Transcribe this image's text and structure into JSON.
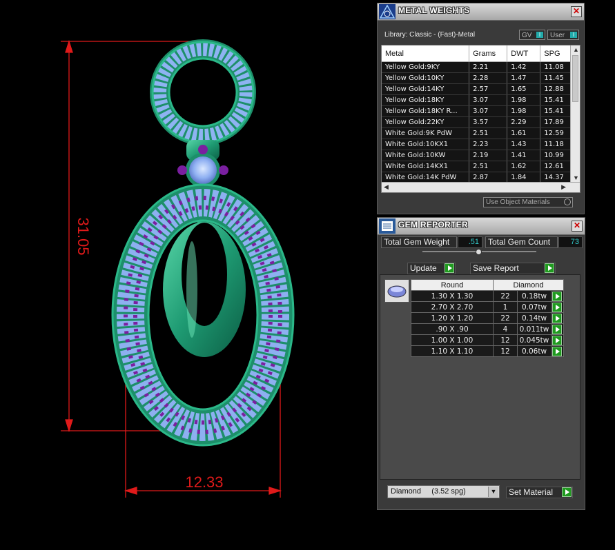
{
  "dimensions": {
    "height_value": "31.05",
    "width_value": "12.33",
    "color": "#e01a1a"
  },
  "metal_weights": {
    "title": "METAL WEIGHTS",
    "library": "Library: Classic - (Fast)-Metal",
    "gv_toggle": "GV",
    "user_toggle": "User",
    "columns": [
      "Metal",
      "Grams",
      "DWT",
      "SPG"
    ],
    "rows": [
      {
        "metal": "Yellow Gold:9KY",
        "grams": "2.21",
        "dwt": "1.42",
        "spg": "11.08"
      },
      {
        "metal": "Yellow Gold:10KY",
        "grams": "2.28",
        "dwt": "1.47",
        "spg": "11.45"
      },
      {
        "metal": "Yellow Gold:14KY",
        "grams": "2.57",
        "dwt": "1.65",
        "spg": "12.88"
      },
      {
        "metal": "Yellow Gold:18KY",
        "grams": "3.07",
        "dwt": "1.98",
        "spg": "15.41"
      },
      {
        "metal": "Yellow Gold:18KY R...",
        "grams": "3.07",
        "dwt": "1.98",
        "spg": "15.41"
      },
      {
        "metal": "Yellow Gold:22KY",
        "grams": "3.57",
        "dwt": "2.29",
        "spg": "17.89"
      },
      {
        "metal": "White Gold:9K PdW",
        "grams": "2.51",
        "dwt": "1.61",
        "spg": "12.59"
      },
      {
        "metal": "White Gold:10KX1",
        "grams": "2.23",
        "dwt": "1.43",
        "spg": "11.18"
      },
      {
        "metal": "White Gold:10KW",
        "grams": "2.19",
        "dwt": "1.41",
        "spg": "10.99"
      },
      {
        "metal": "White Gold:14KX1",
        "grams": "2.51",
        "dwt": "1.62",
        "spg": "12.61"
      },
      {
        "metal": "White Gold:14K PdW",
        "grams": "2.87",
        "dwt": "1.84",
        "spg": "14.37"
      }
    ],
    "use_object_materials": "Use Object Materials"
  },
  "gem_reporter": {
    "title": "GEM REPORTER",
    "total_weight_label": "Total Gem Weight",
    "total_weight_value": ".51",
    "total_count_label": "Total Gem Count",
    "total_count_value": "73",
    "update_label": "Update",
    "save_report_label": "Save Report",
    "shape_header": "Round",
    "material_header": "Diamond",
    "rows": [
      {
        "size": "1.30 X 1.30",
        "count": "22",
        "weight": "0.18tw"
      },
      {
        "size": "2.70 X 2.70",
        "count": "1",
        "weight": "0.07tw"
      },
      {
        "size": "1.20 X 1.20",
        "count": "22",
        "weight": "0.14tw"
      },
      {
        "size": ".90 X .90",
        "count": "4",
        "weight": "0.011tw"
      },
      {
        "size": "1.00 X 1.00",
        "count": "12",
        "weight": "0.045tw"
      },
      {
        "size": "1.10 X 1.10",
        "count": "12",
        "weight": "0.06tw"
      }
    ],
    "material_select": "Diamond     (3.52 spg)",
    "set_material_label": "Set Material"
  }
}
